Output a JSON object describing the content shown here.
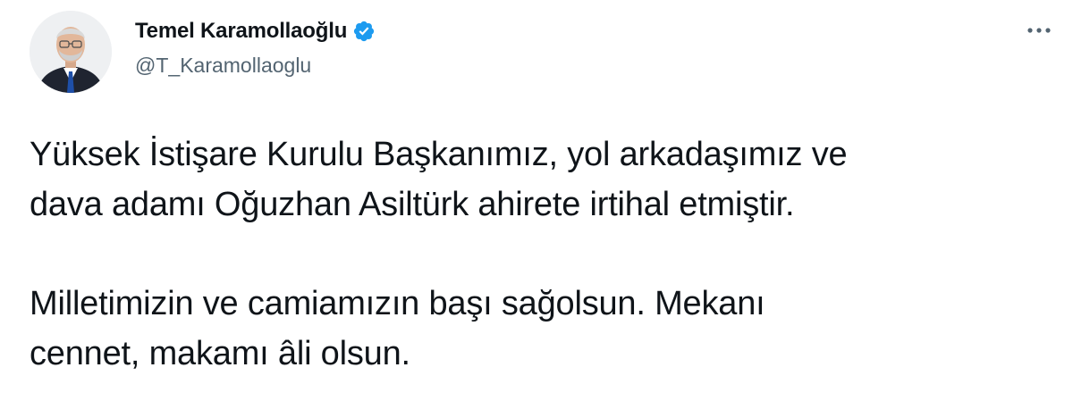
{
  "author": {
    "display_name": "Temel Karamollaoğlu",
    "handle": "@T_Karamollaoglu",
    "verified": true
  },
  "tweet": {
    "paragraph_1_line_1": "Yüksek İstişare Kurulu Başkanımız, yol arkadaşımız ve",
    "paragraph_1_line_2": "dava adamı Oğuzhan Asiltürk ahirete irtihal etmiştir.",
    "paragraph_2_line_1": "Milletimizin ve camiamızın başı sağolsun. Mekanı",
    "paragraph_2_line_2": "cennet, makamı âli olsun."
  },
  "icons": {
    "verified": "verified-badge-icon",
    "more": "more-options-icon"
  },
  "colors": {
    "text_primary": "#0f1419",
    "text_secondary": "#536471",
    "verified_blue": "#1d9bf0",
    "background": "#ffffff"
  }
}
